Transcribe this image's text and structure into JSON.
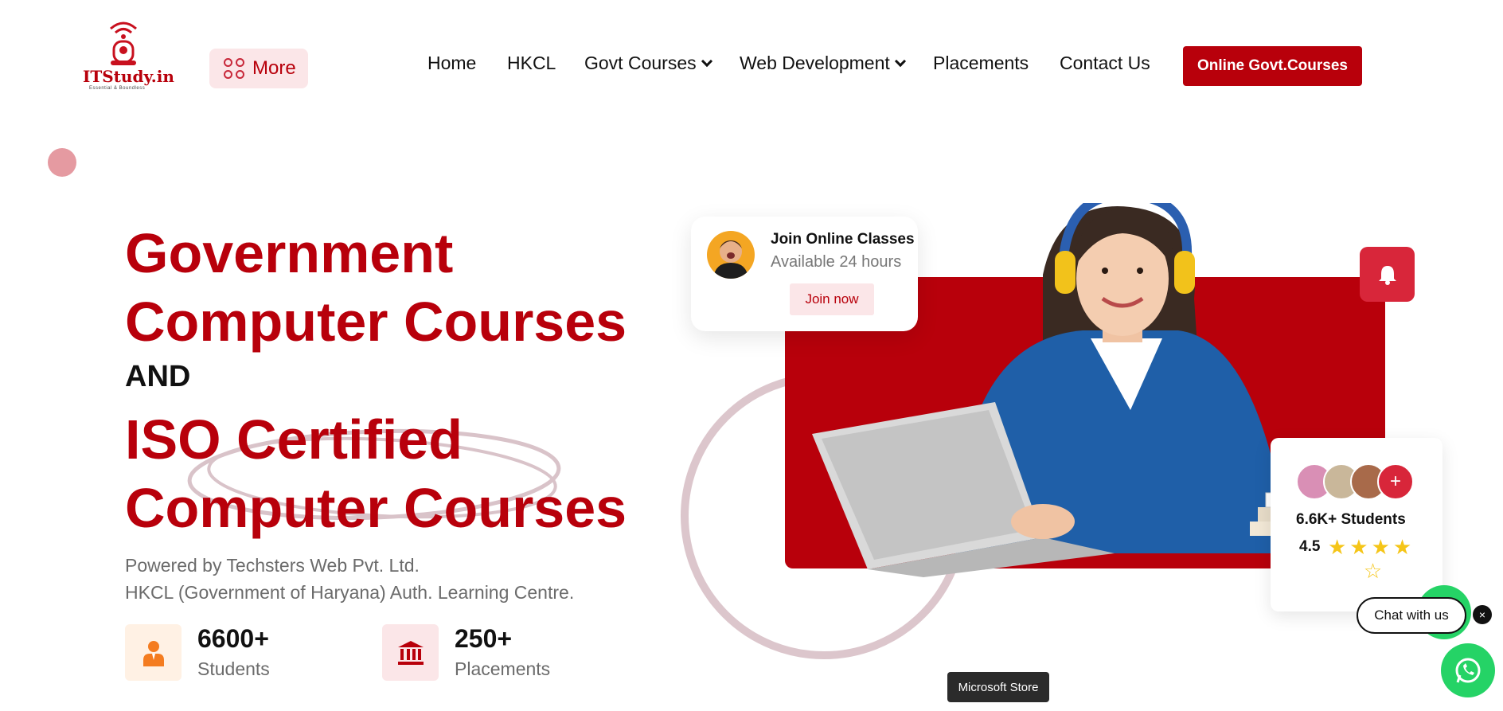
{
  "header": {
    "logo": {
      "brand": "ITStudy.in",
      "tagline": "Essential & Boundless"
    },
    "more_label": "More",
    "nav": [
      {
        "label": "Home"
      },
      {
        "label": "HKCL"
      },
      {
        "label": "Govt Courses"
      },
      {
        "label": "Web Development"
      },
      {
        "label": "Placements"
      },
      {
        "label": "Contact Us"
      }
    ],
    "cta_label": "Online Govt.Courses"
  },
  "hero": {
    "heading_line1": "Government",
    "heading_line2": "Computer Courses",
    "heading_and": "AND",
    "heading_line3": "ISO Certified",
    "heading_line4": "Computer Courses",
    "sub_line1": "Powered by Techsters Web Pvt. Ltd.",
    "sub_line2": "HKCL (Government of Haryana) Auth. Learning Centre.",
    "stats": [
      {
        "value": "6600+",
        "label": "Students",
        "icon": "student-icon"
      },
      {
        "value": "250+",
        "label": "Placements",
        "icon": "bank-icon"
      }
    ]
  },
  "join_card": {
    "title": "Join Online Classes",
    "subtitle": "Available 24 hours",
    "button": "Join now"
  },
  "students_card": {
    "plus": "+",
    "students": "6.6K+ Students",
    "rating": "4.5",
    "stars": 4.5
  },
  "chat": {
    "label": "Chat with us",
    "close": "×"
  },
  "tooltip": "Microsoft Store",
  "colors": {
    "brand": "#b8000b",
    "accent": "#d8263a",
    "whatsapp": "#25d366"
  }
}
